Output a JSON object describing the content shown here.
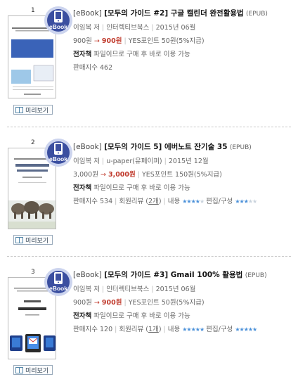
{
  "items": [
    {
      "rank": "1",
      "type": "[eBook]",
      "title": "[모두의 가이드 #2] 구글 캘린더 완전활용법",
      "format": "(EPUB)",
      "author": "이임복 저",
      "publisher": "인터렉티브북스",
      "date": "2015년 06월",
      "price_original": "900원",
      "price_sale": "900원",
      "points": "YES포인트 50원(5%지급)",
      "ebook_label": "전자책",
      "ebook_note": "파일이므로 구매 후 바로 이용 가능",
      "sales": "판매지수 462",
      "preview_label": "미리보기",
      "cover_title": "구글 캘린더 완전활용법",
      "badge": "eBook"
    },
    {
      "rank": "2",
      "type": "[eBook]",
      "title": "[모두의 가이드 5] 에버노트 잔기술 35",
      "format": "(EPUB)",
      "author": "이임복 저",
      "publisher": "u-paper(유페이퍼)",
      "date": "2015년 12월",
      "price_original": "3,000원",
      "price_sale": "3,000원",
      "points": "YES포인트 150원(5%지급)",
      "ebook_label": "전자책",
      "ebook_note": "파일이므로 구매 후 바로 이용 가능",
      "sales": "판매지수 534",
      "review_prefix": "회원리뷰 (",
      "review_count": "2개",
      "review_suffix": ")",
      "content_label": "내용",
      "content_rating": 4,
      "edit_label": "편집/구성",
      "edit_rating": 3,
      "preview_label": "미리보기",
      "cover_title": "EVERNOTE 잔기술 35",
      "badge": "eBook"
    },
    {
      "rank": "3",
      "type": "[eBook]",
      "title": "[모두의 가이드 #3] Gmail 100% 활용법",
      "format": "(EPUB)",
      "author": "이임복 저",
      "publisher": "인터렉티브북스",
      "date": "2015년 06월",
      "price_original": "900원",
      "price_sale": "900원",
      "points": "YES포인트 50원(5%지급)",
      "ebook_label": "전자책",
      "ebook_note": "파일이므로 구매 후 바로 이용 가능",
      "sales": "판매지수 120",
      "review_prefix": "회원리뷰 (",
      "review_count": "1개",
      "review_suffix": ")",
      "content_label": "내용",
      "content_rating": 5,
      "edit_label": "편집/구성",
      "edit_rating": 5,
      "preview_label": "미리보기",
      "cover_title": "Gmail 완전 활용법",
      "badge": "eBook"
    }
  ],
  "arrow": "→",
  "colors": {
    "accent": "#c0392b",
    "star": "#4a90d9",
    "badge": "#3b4fa0"
  }
}
